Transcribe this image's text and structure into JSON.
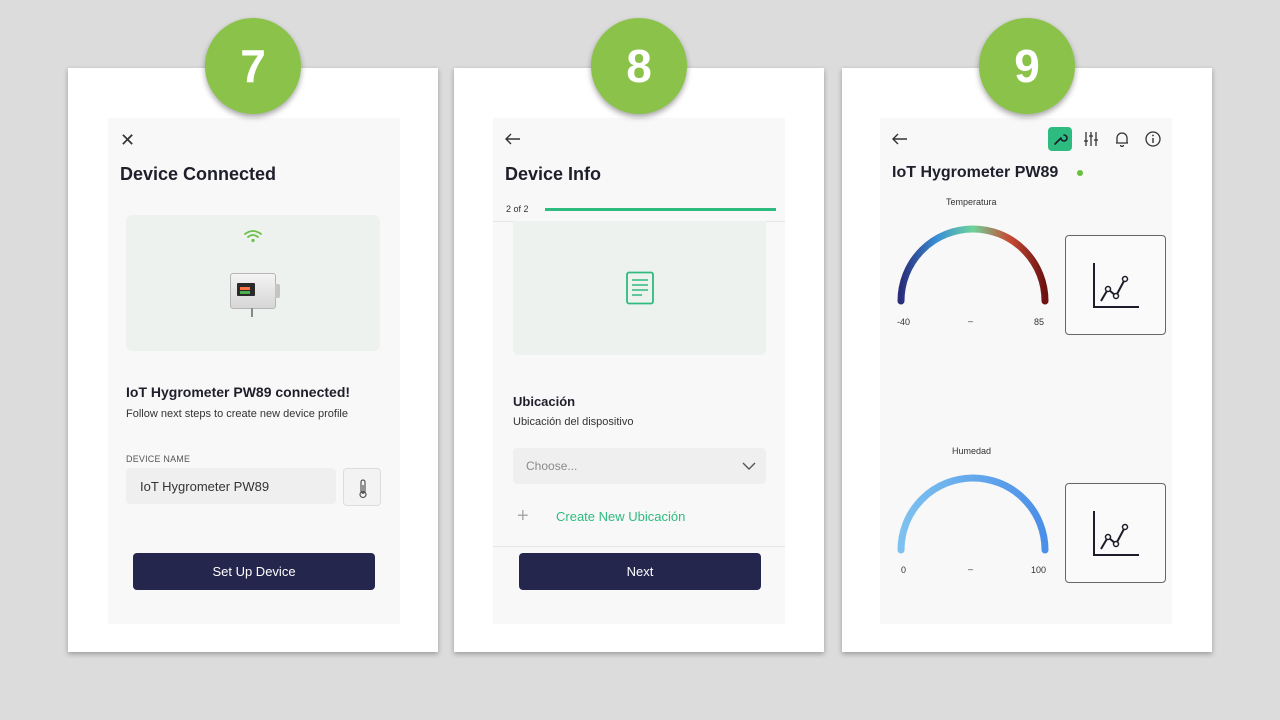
{
  "steps": [
    "7",
    "8",
    "9"
  ],
  "screen7": {
    "title": "Device Connected",
    "headline": "IoT Hygrometer PW89 connected!",
    "subtitle": "Follow next steps to create new device profile",
    "field_label": "DEVICE NAME",
    "device_name": "IoT Hygrometer PW89",
    "button_label": "Set Up Device"
  },
  "screen8": {
    "title": "Device Info",
    "progress_text": "2 of 2",
    "progress_fraction": 1.0,
    "field_title": "Ubicación",
    "field_subtitle": "Ubicación del dispositivo",
    "select_placeholder": "Choose...",
    "create_label": "Create New Ubicación",
    "button_label": "Next"
  },
  "screen9": {
    "title": "IoT Hygrometer PW89",
    "status_color": "#67c23a",
    "toolbar_icons": [
      "wrench-icon",
      "sliders-icon",
      "bell-icon",
      "info-icon"
    ],
    "widgets": [
      {
        "label": "Temperatura",
        "min": "-40",
        "max": "85",
        "value": "–"
      },
      {
        "label": "Humedad",
        "min": "0",
        "max": "100",
        "value": "–"
      }
    ]
  },
  "colors": {
    "accent": "#2ebb7f",
    "primary_button": "#25264d",
    "step_badge": "#8bc34a"
  }
}
